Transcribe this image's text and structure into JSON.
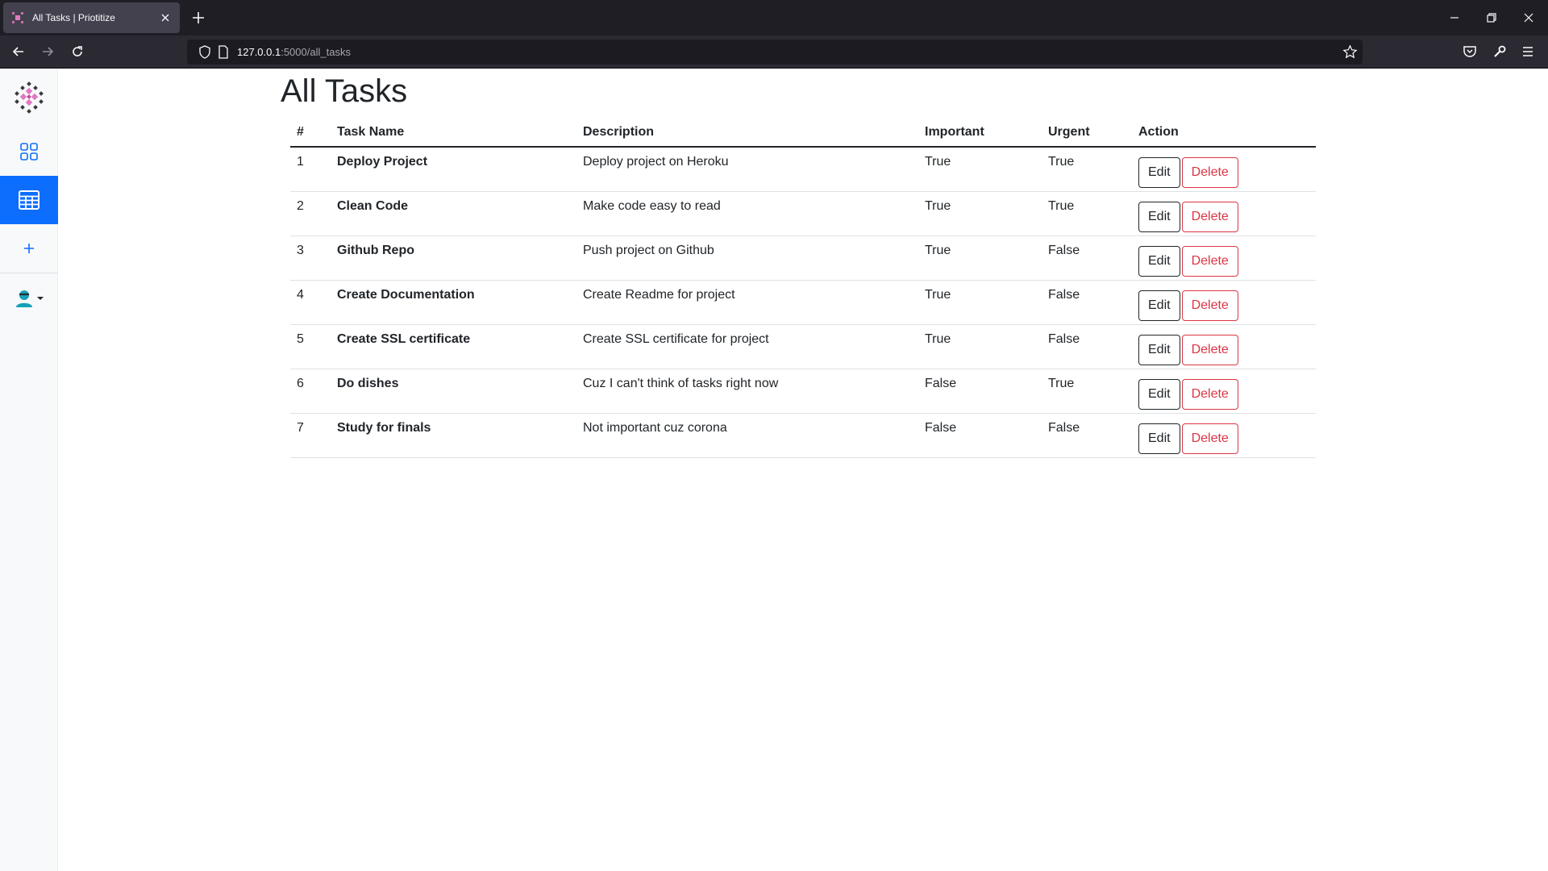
{
  "browser": {
    "tab_title": "All Tasks | Priotitize",
    "url_host": "127.0.0.1",
    "url_path": ":5000/all_tasks",
    "icons": [
      "favicon",
      "close-icon",
      "plus-icon",
      "minimize-icon",
      "restore-icon",
      "close-window-icon",
      "back-arrow-icon",
      "forward-arrow-icon",
      "reload-icon",
      "shield-icon",
      "page-icon",
      "bookmark-star-icon",
      "pocket-icon",
      "wrench-icon",
      "menu-icon"
    ]
  },
  "sidebar": {
    "items": [
      {
        "name": "dashboard",
        "icon": "grid-icon",
        "active": false
      },
      {
        "name": "all-tasks",
        "icon": "table-icon",
        "active": true
      },
      {
        "name": "add-task",
        "icon": "plus-icon",
        "active": false
      }
    ],
    "user_icon": "user-avatar-icon",
    "accent_color": "#0d6efd"
  },
  "page": {
    "title": "All Tasks"
  },
  "table": {
    "columns": [
      "#",
      "Task Name",
      "Description",
      "Important",
      "Urgent",
      "Action"
    ],
    "rows": [
      {
        "num": "1",
        "name": "Deploy Project",
        "description": "Deploy project on Heroku",
        "important": "True",
        "urgent": "True"
      },
      {
        "num": "2",
        "name": "Clean Code",
        "description": "Make code easy to read",
        "important": "True",
        "urgent": "True"
      },
      {
        "num": "3",
        "name": "Github Repo",
        "description": "Push project on Github",
        "important": "True",
        "urgent": "False"
      },
      {
        "num": "4",
        "name": "Create Documentation",
        "description": "Create Readme for project",
        "important": "True",
        "urgent": "False"
      },
      {
        "num": "5",
        "name": "Create SSL certificate",
        "description": "Create SSL certificate for project",
        "important": "True",
        "urgent": "False"
      },
      {
        "num": "6",
        "name": "Do dishes",
        "description": "Cuz I can't think of tasks right now",
        "important": "False",
        "urgent": "True"
      },
      {
        "num": "7",
        "name": "Study for finals",
        "description": "Not important cuz corona",
        "important": "False",
        "urgent": "False"
      }
    ],
    "edit_label": "Edit",
    "delete_label": "Delete",
    "delete_color": "#dc3545"
  }
}
